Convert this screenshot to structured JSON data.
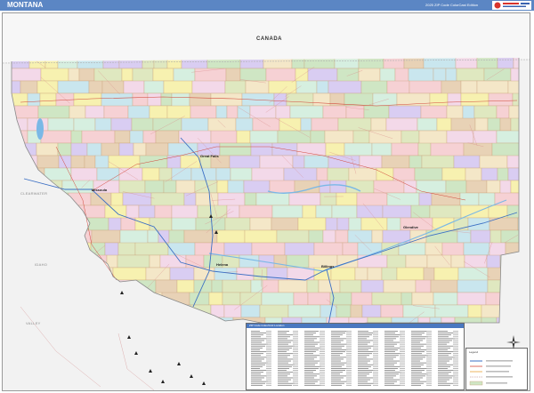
{
  "header": {
    "title": "MONTANA",
    "subtitle": "2025 ZIP Code ColorCast Edition"
  },
  "map": {
    "colors": {
      "header": "#5b86c4",
      "water": "#7ab8e6",
      "zip_border": "#c9a27a",
      "county_border": "#b07c7c",
      "interstate": "#3b6fc4",
      "highway": "#d2473a",
      "outside_state": "#f2f2f2"
    },
    "country_label": "CANADA",
    "cities": [
      "Great Falls",
      "Missoula",
      "Helena",
      "Billings",
      "Glendive"
    ],
    "neighbor_labels": [
      "IDAHO",
      "WYOMING",
      "VALLEY",
      "CLEARWATER"
    ],
    "zip_index_title": "ZIP Code Index/Grid Location",
    "legend_title": "Legend"
  }
}
